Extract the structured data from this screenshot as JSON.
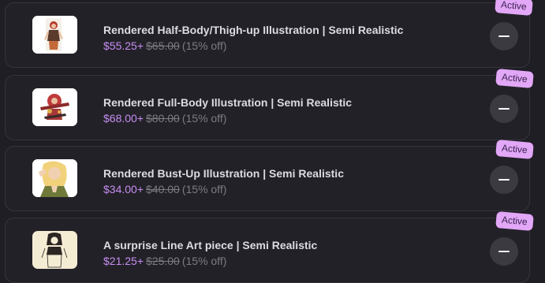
{
  "items": [
    {
      "title": "Rendered Half-Body/Thigh-up Illustration | Semi Realistic",
      "sale_price": "$55.25+",
      "original_price": "$65.00",
      "discount": "(15% off)",
      "badge": "Active",
      "thumbnail_icon": "half-body-illustration-thumbnail",
      "remove_icon": "minus-icon"
    },
    {
      "title": "Rendered Full-Body Illustration | Semi Realistic",
      "sale_price": "$68.00+",
      "original_price": "$80.00",
      "discount": "(15% off)",
      "badge": "Active",
      "thumbnail_icon": "full-body-illustration-thumbnail",
      "remove_icon": "minus-icon"
    },
    {
      "title": "Rendered Bust-Up Illustration | Semi Realistic",
      "sale_price": "$34.00+",
      "original_price": "$40.00",
      "discount": "(15% off)",
      "badge": "Active",
      "thumbnail_icon": "bust-up-illustration-thumbnail",
      "remove_icon": "minus-icon"
    },
    {
      "title": "A surprise Line Art piece | Semi Realistic",
      "sale_price": "$21.25+",
      "original_price": "$25.00",
      "discount": "(15% off)",
      "badge": "Active",
      "thumbnail_icon": "line-art-thumbnail",
      "remove_icon": "minus-icon"
    }
  ],
  "colors": {
    "background": "#201e25",
    "card": "#232128",
    "card_border": "#35333b",
    "title": "#dddbe2",
    "sale_price": "#c68ef2",
    "muted": "#7c7a82",
    "badge_bg": "#e2a7f7",
    "badge_text": "#3a2150",
    "button_bg": "#3b3a41"
  }
}
